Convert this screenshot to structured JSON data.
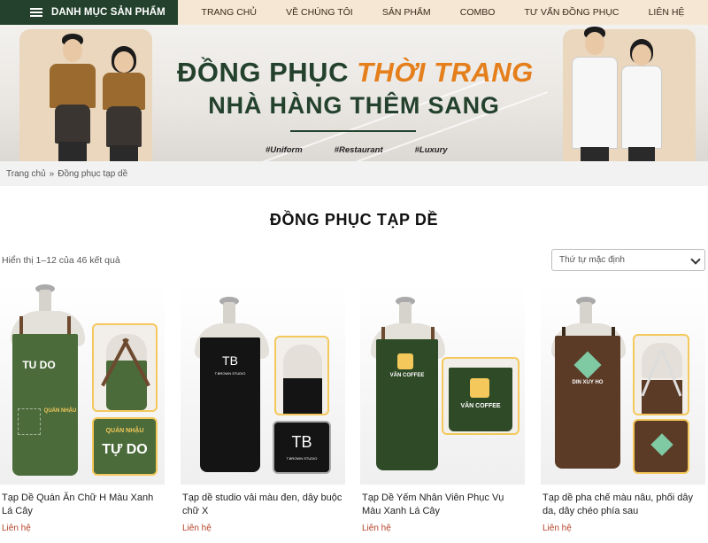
{
  "nav": {
    "category_label": "DANH MỤC SẢN PHẨM",
    "items": [
      "TRANG CHỦ",
      "VỀ CHÚNG TÔI",
      "SẢN PHẨM",
      "COMBO",
      "TƯ VẤN ĐỒNG PHỤC",
      "LIÊN HỆ"
    ]
  },
  "banner": {
    "title_part1": "ĐỒNG PHỤC ",
    "title_part2": "THỜI TRANG",
    "title_line2": "NHÀ HÀNG THÊM SANG",
    "tags": [
      "#Uniform",
      "#Restaurant",
      "#Luxury"
    ]
  },
  "breadcrumb": {
    "home": "Trang chủ",
    "separator": "»",
    "current": "Đồng phục tạp dề"
  },
  "page_title": "ĐỒNG PHỤC TẠP DỀ",
  "result_count": "Hiển thị 1–12 của 46 kết quả",
  "sort": {
    "selected": "Thứ tự mặc định"
  },
  "products": [
    {
      "name": "Tạp Dề Quán Ăn Chữ H Màu Xanh Lá Cây",
      "price": "Liên hệ",
      "logo_top": "TU DO",
      "logo_sub": "QUÁN NHẬU",
      "logo_inset": "TỰ DO"
    },
    {
      "name": "Tạp dề studio vải màu đen, dây buộc chữ X",
      "price": "Liên hệ",
      "logo_top": "TB",
      "logo_sub": "T.BROWN STUDIO",
      "logo_inset": "TB"
    },
    {
      "name": "Tạp Dề Yếm Nhân Viên Phục Vụ Màu Xanh Lá Cây",
      "price": "Liên hệ",
      "logo_top": "VÂN COFFEE",
      "logo_sub": "",
      "logo_inset": "VÂN COFFEE"
    },
    {
      "name": "Tạp dề pha chế màu nâu, phối dây da, dây chéo phía sau",
      "price": "Liên hệ",
      "logo_top": "DIN XUY HO",
      "logo_sub": "",
      "logo_inset": ""
    }
  ],
  "colors": {
    "brand_green": "#23412c",
    "accent_orange": "#e47f1c",
    "nav_bg": "#f5e7d3",
    "price_red": "#b5442b"
  },
  "icons": {
    "menu": "hamburger-icon",
    "sort_dropdown": "chevron-down-icon"
  }
}
